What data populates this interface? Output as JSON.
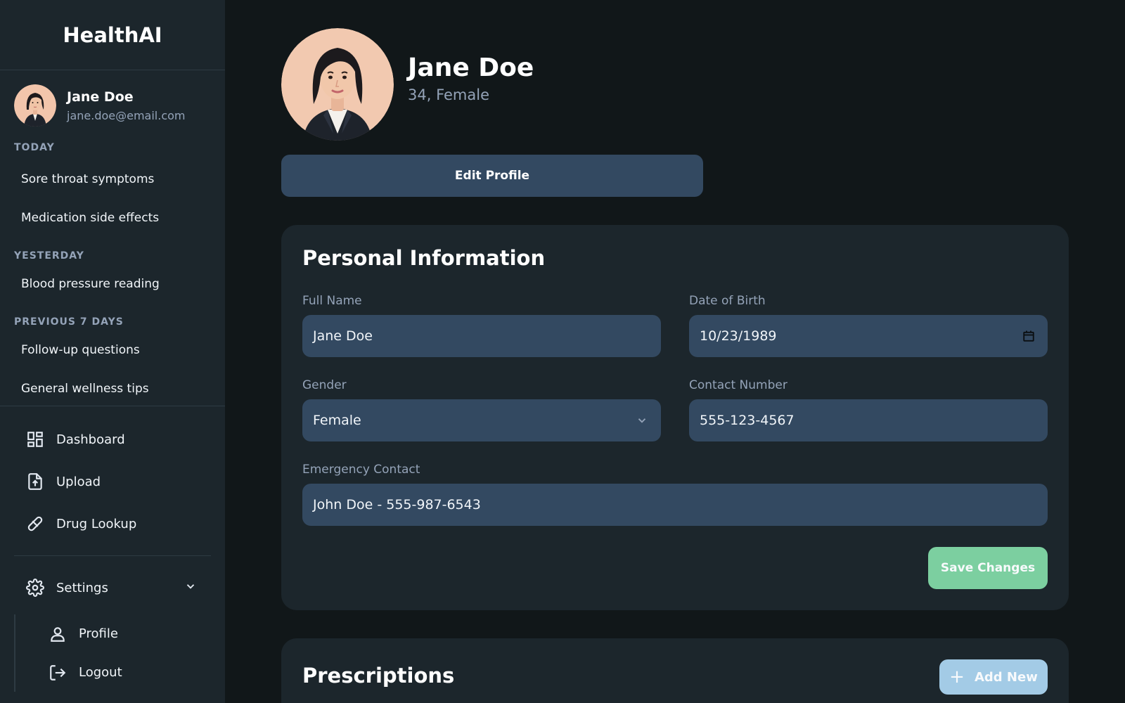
{
  "app": {
    "brand": "HealthAI"
  },
  "user": {
    "name": "Jane Doe",
    "email": "jane.doe@email.com"
  },
  "history": {
    "groups": [
      {
        "label": "TODAY",
        "items": [
          "Sore throat symptoms",
          "Medication side effects"
        ]
      },
      {
        "label": "YESTERDAY",
        "items": [
          "Blood pressure reading"
        ]
      },
      {
        "label": "PREVIOUS 7 DAYS",
        "items": [
          "Follow-up questions",
          "General wellness tips"
        ]
      }
    ]
  },
  "nav": {
    "dashboard": "Dashboard",
    "upload": "Upload",
    "drug_lookup": "Drug Lookup",
    "settings": "Settings",
    "profile": "Profile",
    "logout": "Logout"
  },
  "profile": {
    "name": "Jane Doe",
    "summary": "34, Female",
    "edit_label": "Edit Profile"
  },
  "personal_info": {
    "title": "Personal Information",
    "full_name": {
      "label": "Full Name",
      "value": "Jane Doe"
    },
    "dob": {
      "label": "Date of Birth",
      "value": "10/23/1989"
    },
    "gender": {
      "label": "Gender",
      "value": "Female"
    },
    "contact": {
      "label": "Contact Number",
      "value": "555-123-4567"
    },
    "emergency": {
      "label": "Emergency Contact",
      "value": "John Doe - 555-987-6543"
    },
    "save_label": "Save Changes"
  },
  "prescriptions": {
    "title": "Prescriptions",
    "add_label": "Add New"
  },
  "colors": {
    "background": "#111719",
    "panel": "#1c262c",
    "field": "#334961",
    "save_accent": "#7ccfa0",
    "add_accent": "#a3cbe6"
  }
}
